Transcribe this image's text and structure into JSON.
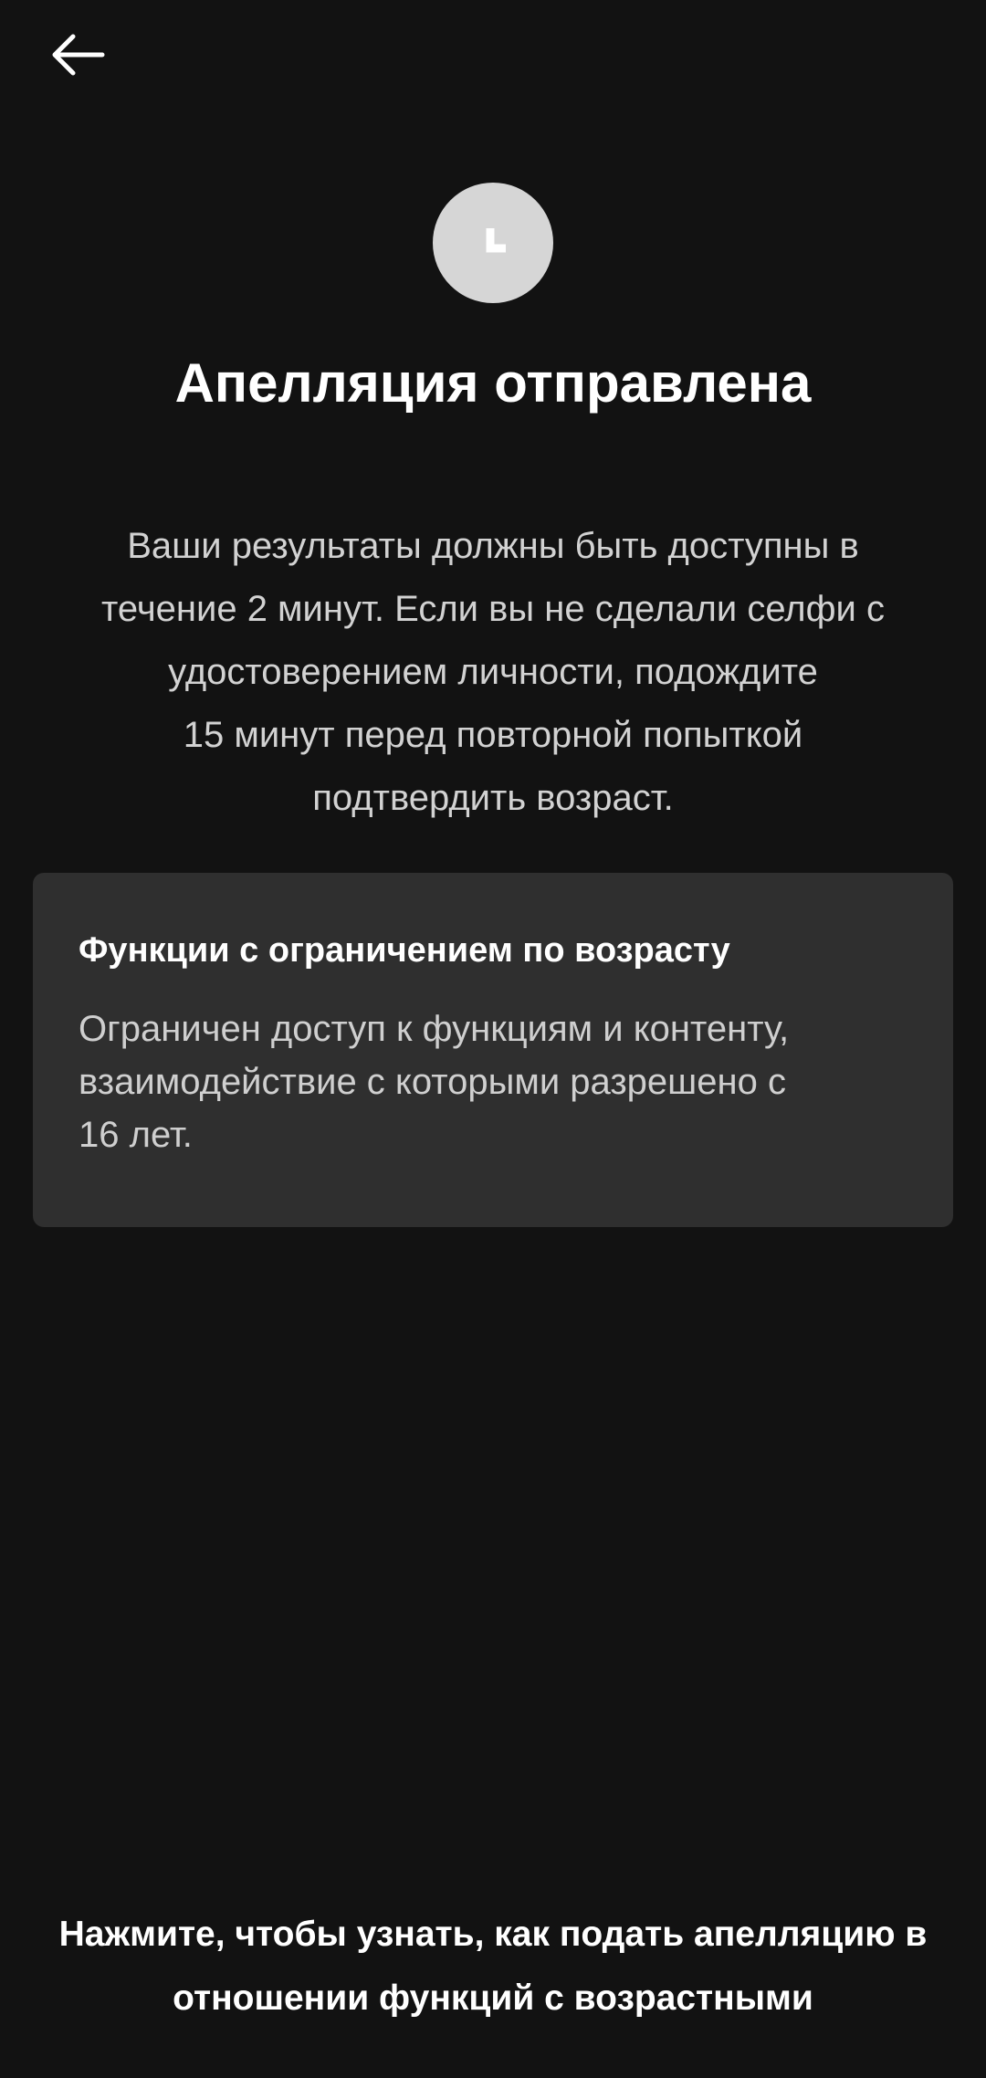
{
  "header": {
    "back_icon": "arrow-left-icon"
  },
  "status": {
    "icon": "clock-icon",
    "icon_color": "#d6d6d6"
  },
  "title": "Апелляция отправлена",
  "description_lines": [
    "Ваши результаты должны быть доступны в",
    "течение 2 минут. Если вы не сделали селфи с",
    "удостоверением личности, подождите",
    "15 минут перед повторной попыткой",
    "подтвердить возраст."
  ],
  "card": {
    "title": "Функции с ограничением по возрасту",
    "body_lines": [
      "Ограничен доступ к функциям и контенту,",
      "взаимодействие с которыми разрешено с",
      "16 лет."
    ],
    "background": "#2f2f2f"
  },
  "footer_link": {
    "lines": [
      "Нажмите, чтобы узнать, как подать апелляцию в",
      "отношении функций с возрастными"
    ]
  },
  "colors": {
    "background": "#121212",
    "text_primary": "#ffffff",
    "text_secondary": "#d2d2d2"
  }
}
